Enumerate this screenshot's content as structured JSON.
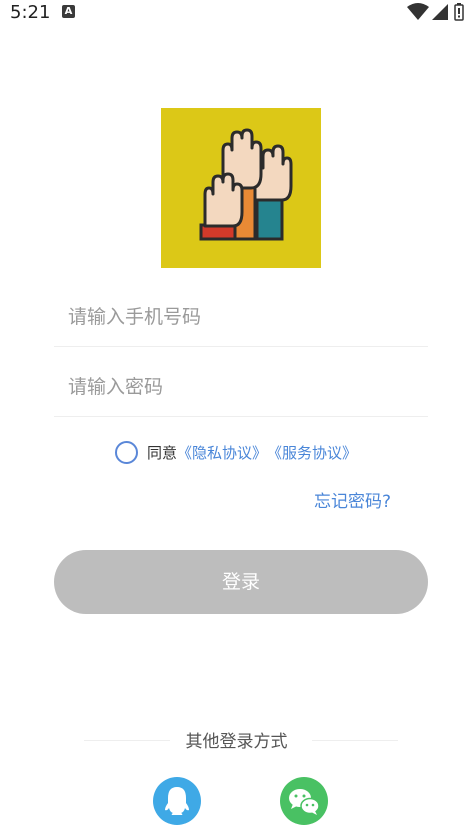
{
  "status_bar": {
    "time": "5:21",
    "app_icon_letter": "A"
  },
  "login": {
    "phone_placeholder": "请输入手机号码",
    "password_placeholder": "请输入密码",
    "agree_prefix": "同意",
    "privacy_link": "《隐私协议》",
    "service_link": "《服务协议》",
    "forgot_password": "忘记密码?",
    "login_button": "登录"
  },
  "other_login": {
    "title": "其他登录方式",
    "methods": [
      {
        "icon": "qq-icon",
        "color": "#3fa9e6"
      },
      {
        "icon": "wechat-icon",
        "color": "#49c163"
      }
    ]
  }
}
